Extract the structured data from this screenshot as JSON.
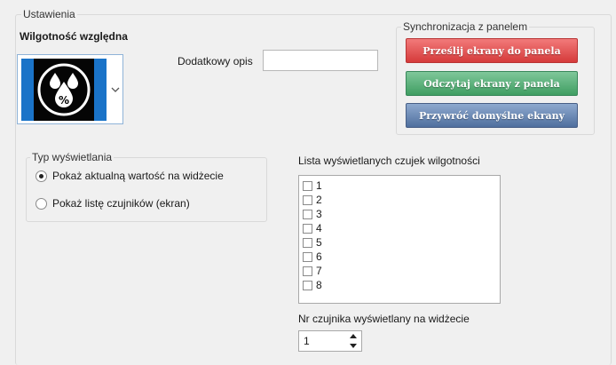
{
  "settings": {
    "legend": "Ustawienia",
    "title": "Wilgotność względna",
    "icon": {
      "name": "humidity-percent-icon",
      "accent": "#1a73c8"
    },
    "extra_desc_label": "Dodatkowy opis",
    "extra_desc_value": ""
  },
  "sync": {
    "legend": "Synchronizacja z panelem",
    "send_label": "Prześlij ekrany do panela",
    "read_label": "Odczytaj ekrany z panela",
    "restore_label": "Przywróć domyślne ekrany",
    "colors": {
      "send": "#d53a3a",
      "read": "#3f9e62",
      "restore": "#4f6f9e"
    }
  },
  "display_type": {
    "legend": "Typ wyświetlania",
    "options": [
      {
        "label": "Pokaż aktualną wartość na widżecie",
        "checked": true
      },
      {
        "label": "Pokaż listę czujników (ekran)",
        "checked": false
      }
    ]
  },
  "sensor_list": {
    "label": "Lista wyświetlanych czujek wilgotności",
    "items": [
      "1",
      "2",
      "3",
      "4",
      "5",
      "6",
      "7",
      "8"
    ]
  },
  "widget_sensor": {
    "label": "Nr czujnika wyświetlany na widżecie",
    "value": "1"
  }
}
